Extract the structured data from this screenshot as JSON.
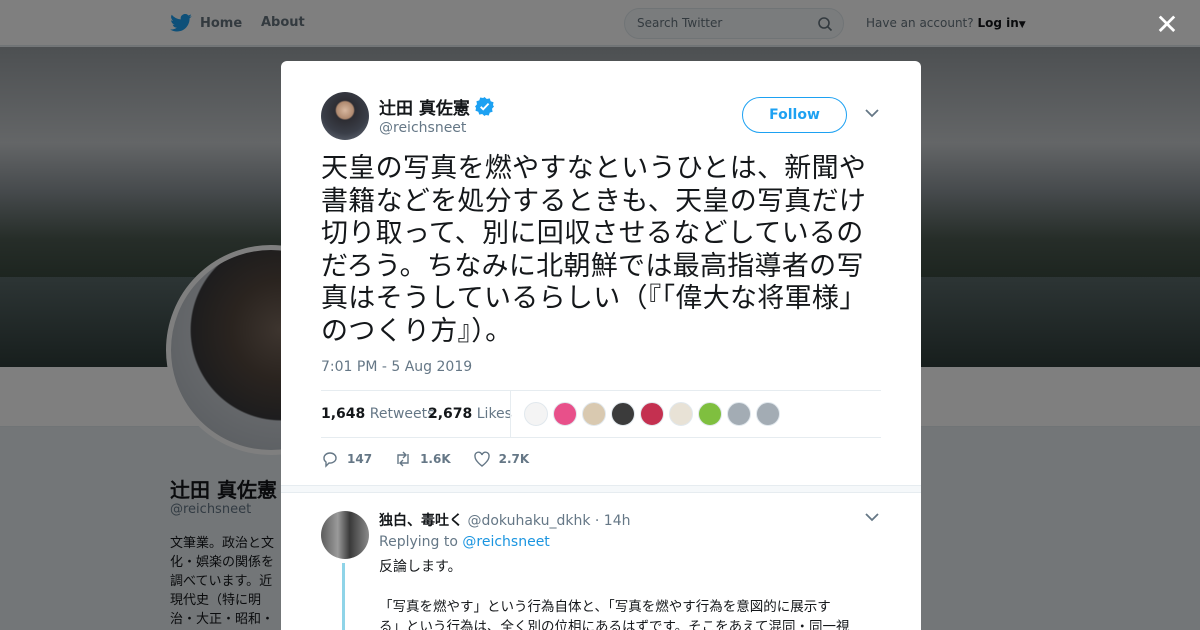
{
  "topbar": {
    "home_label": "Home",
    "about_label": "About",
    "search_placeholder": "Search Twitter",
    "account_prompt": "Have an account?",
    "login_label": "Log in"
  },
  "profile": {
    "name": "辻田 真佐憲",
    "handle": "@reichsneet",
    "bio": "文筆業。政治と文化・娯楽の関係を調べています。近現代史（特に明治・大正・昭和・軍歌・プロパガンダ）書）。連絡先は以下へお願いします。"
  },
  "modal": {
    "close_label": "✕",
    "author": {
      "name": "辻田 真佐憲",
      "handle": "@reichsneet",
      "follow_label": "Follow"
    },
    "tweet_text": "天皇の写真を燃やすなというひとは、新聞や書籍などを処分するときも、天皇の写真だけ切り取って、別に回収させるなどしているのだろう。ちなみに北朝鮮では最高指導者の写真はそうしているらしい（『「偉大な将軍様」のつくり方』）。",
    "timestamp": "7:01 PM - 5 Aug 2019",
    "stats": {
      "retweets_count": "1,648",
      "retweets_label": "Retweets",
      "likes_count": "2,678",
      "likes_label": "Likes"
    },
    "liker_colors": [
      "#f4f4f4",
      "#e8508a",
      "#d9c9b0",
      "#3b3b3b",
      "#c43050",
      "#e8e2d6",
      "#7fbf3f",
      "#a3acb4",
      "#a3acb4"
    ],
    "actions": {
      "replies": "147",
      "retweets": "1.6K",
      "likes": "2.7K"
    },
    "reply": {
      "name": "独白、毒吐く",
      "handle": "@dokuhaku_dkhk",
      "time": "· 14h",
      "replying_prefix": "Replying to",
      "replying_to": "@reichsneet",
      "line1": "反論します。",
      "line2": "「写真を燃やす」という行為自体と、「写真を燃やす行為を意図的に展示す",
      "line3": "る」という行為は、全く別の位相にあるはずです。そこをあえて混同・同一視"
    }
  },
  "colors": {
    "accent": "#1da1f2",
    "overlay": "rgba(0,0,0,0.5)"
  }
}
